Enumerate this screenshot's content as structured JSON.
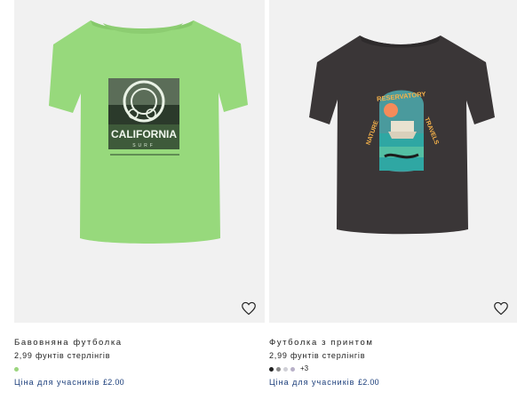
{
  "products": [
    {
      "name": "Бавовняна футболка",
      "price": "2,99 фунтів стерлінгів",
      "member_label": "Ціна для учасників",
      "member_price": "£2.00",
      "print_text": "CALIFORNIA",
      "print_sub": "SURF",
      "swatch_colors": [
        "#9cd57e"
      ],
      "more_colors": ""
    },
    {
      "name": "Футболка з принтом",
      "price": "2,99 фунтів стерлінгів",
      "member_label": "Ціна для учасників",
      "member_price": "£2.00",
      "print_text": "NATURE RESERVATORY TRAVELS",
      "swatch_colors": [
        "#222222",
        "#8a8a8a",
        "#cfcfd6",
        "#b8b0c8"
      ],
      "more_colors": "+3"
    }
  ],
  "colors": {
    "shirt_green": "#97d97c",
    "shirt_charcoal": "#3a3637",
    "photo_bg": "#f1f1f1"
  },
  "icons": [
    "heart-icon"
  ]
}
